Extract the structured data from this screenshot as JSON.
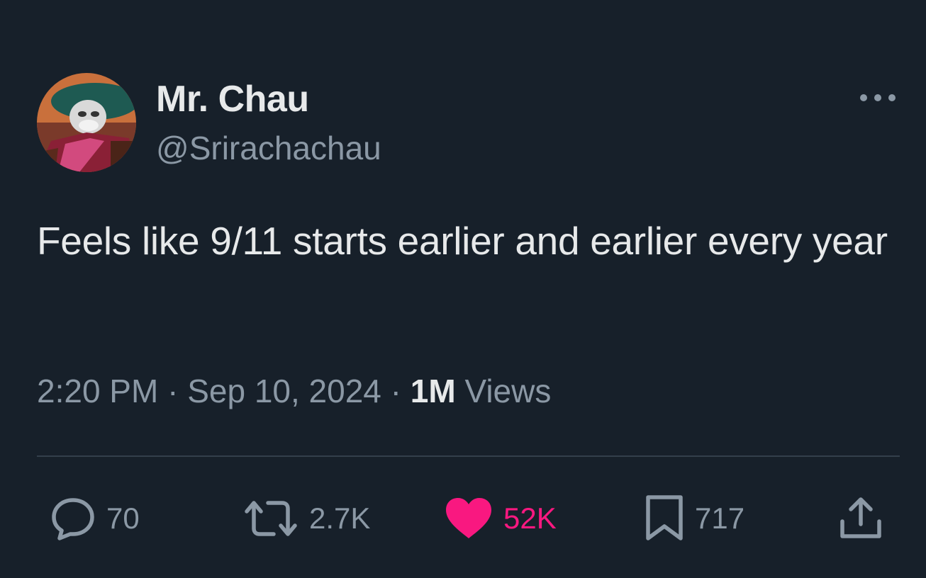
{
  "author": {
    "display_name": "Mr. Chau",
    "handle": "@Srirachachau",
    "avatar_icon": "cartoon-rabbit-avatar-icon"
  },
  "menu": {
    "icon": "more-options-icon"
  },
  "tweet": {
    "text": "Feels like 9/11 starts earlier and earlier every year"
  },
  "meta": {
    "time": "2:20 PM",
    "separator": "·",
    "date": "Sep 10, 2024",
    "views_count": "1M",
    "views_label": "Views"
  },
  "actions": {
    "reply": {
      "icon": "reply-icon",
      "count": "70"
    },
    "retweet": {
      "icon": "retweet-icon",
      "count": "2.7K"
    },
    "like": {
      "icon": "heart-icon",
      "count": "52K",
      "active": true
    },
    "bookmark": {
      "icon": "bookmark-icon",
      "count": "717"
    },
    "share": {
      "icon": "share-icon"
    }
  },
  "colors": {
    "background": "#17202a",
    "primary_text": "#e7e9ea",
    "secondary_text": "#8b98a5",
    "divider": "#333f4b",
    "like": "#f91880"
  }
}
